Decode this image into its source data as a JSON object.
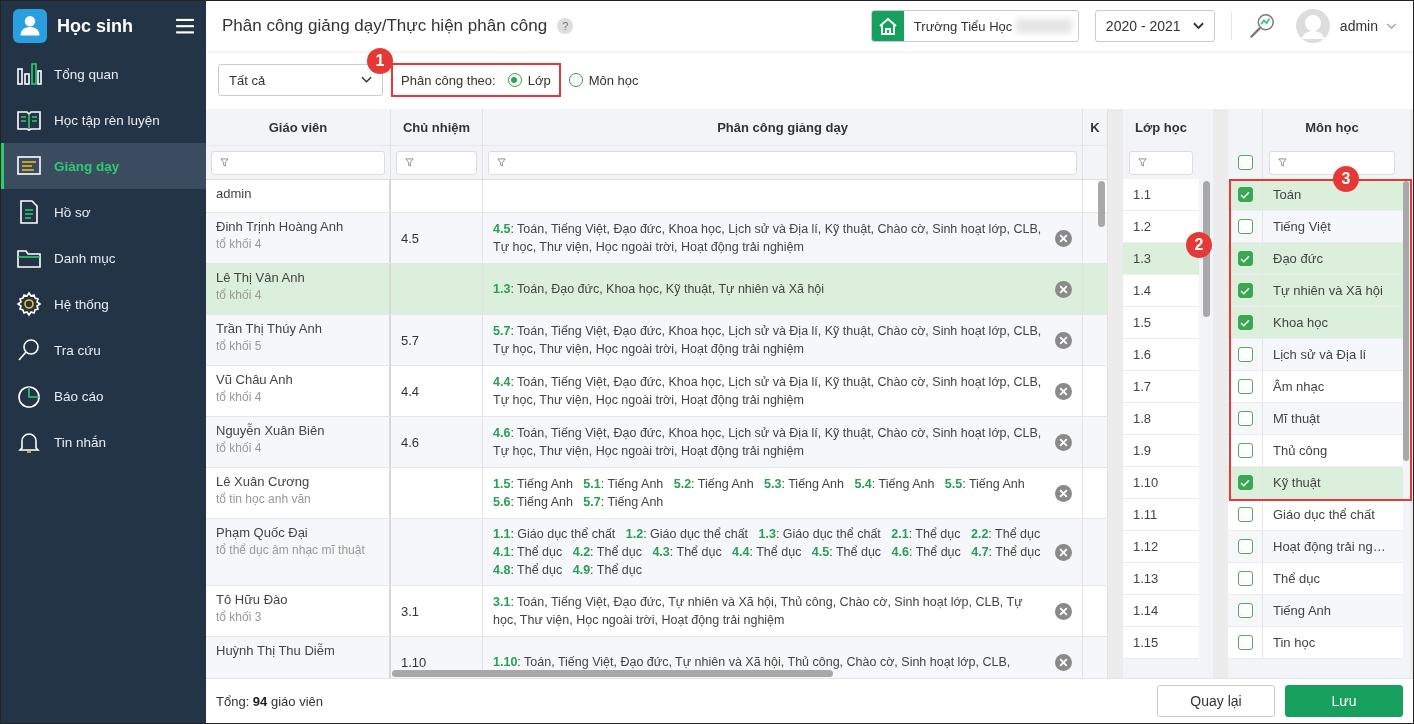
{
  "app": {
    "name": "Học sinh"
  },
  "sidebar": {
    "items": [
      {
        "label": "Tổng quan",
        "selected": false
      },
      {
        "label": "Học tập rèn luyện",
        "selected": false
      },
      {
        "label": "Giảng dạy",
        "selected": true
      },
      {
        "label": "Hồ sơ",
        "selected": false
      },
      {
        "label": "Danh mục",
        "selected": false
      },
      {
        "label": "Hệ thống",
        "selected": false
      },
      {
        "label": "Tra cứu",
        "selected": false
      },
      {
        "label": "Báo cáo",
        "selected": false
      },
      {
        "label": "Tin nhắn",
        "selected": false
      }
    ]
  },
  "header": {
    "title": "Phân công giảng dạy/Thực hiện phân công",
    "help": "?",
    "school": "Trường Tiểu Học",
    "year": "2020 - 2021",
    "user": "admin"
  },
  "toolbar": {
    "filter": "Tất cả",
    "assign_by_label": "Phân công theo:",
    "options": [
      {
        "label": "Lớp",
        "selected": true
      },
      {
        "label": "Môn học",
        "selected": false
      }
    ]
  },
  "teachers": {
    "columns": [
      "Giáo viên",
      "Chủ nhiệm",
      "Phân công giảng dạy",
      "K"
    ],
    "rows": [
      {
        "name": "admin",
        "selected": false
      },
      {
        "name": "Đinh Trịnh Hoàng Anh",
        "group": "tổ khối 4",
        "homeroom": "4.5",
        "assignment": "**4.5**: Toán, Tiếng Việt, Đạo đức, Khoa học, Lịch sử và Địa lí, Kỹ thuật, Chào cờ, Sinh hoạt lớp, CLB, Tự học, Thư viện, Học ngoài trời, Hoạt động trải nghiệm",
        "selected": false
      },
      {
        "name": "Lê Thị Vân Anh",
        "group": "tổ khối 4",
        "assignment": "**1.3**: Toán, Đạo đức, Khoa học, Kỹ thuật, Tự nhiên và Xã hội",
        "selected": true
      },
      {
        "name": "Trần Thị Thúy Anh",
        "group": "tổ khối 5",
        "homeroom": "5.7",
        "assignment": "**5.7**: Toán, Tiếng Việt, Đạo đức, Khoa học, Lịch sử và Địa lí, Kỹ thuật, Chào cờ, Sinh hoạt lớp, CLB, Tự học, Thư viện, Học ngoài trời, Hoạt động trải nghiệm",
        "selected": false
      },
      {
        "name": "Vũ Châu Anh",
        "group": "tổ khối 4",
        "homeroom": "4.4",
        "assignment": "**4.4**: Toán, Tiếng Việt, Đạo đức, Khoa học, Lịch sử và Địa lí, Kỹ thuật, Chào cờ, Sinh hoạt lớp, CLB, Tự học, Thư viện, Học ngoài trời, Hoạt động trải nghiệm",
        "selected": false
      },
      {
        "name": "Nguyễn Xuân Biên",
        "group": "tổ khối 4",
        "homeroom": "4.6",
        "assignment": "**4.6**: Toán, Tiếng Việt, Đạo đức, Khoa học, Lịch sử và Địa lí, Kỹ thuật, Chào cờ, Sinh hoạt lớp, CLB, Tự học, Thư viện, Học ngoài trời, Hoạt động trải nghiệm",
        "selected": false
      },
      {
        "name": "Lê Xuân Cương",
        "group": "tổ tin học anh văn",
        "assignment": "**1.5**: Tiếng Anh   **5.1**: Tiếng Anh   **5.2**: Tiếng Anh   **5.3**: Tiếng Anh   **5.4**: Tiếng Anh   **5.5**: Tiếng Anh   **5.6**: Tiếng Anh   **5.7**: Tiếng Anh",
        "selected": false
      },
      {
        "name": "Phạm Quốc Đại",
        "group": "tổ thể dục âm nhạc mĩ thuật",
        "assignment": "**1.1**: Giáo dục thể chất   **1.2**: Giáo dục thể chất   **1.3**: Giáo dục thể chất   **2.1**: Thể dục   **2.2**: Thể dục   **4.1**: Thể dục   **4.2**: Thể dục   **4.3**: Thể dục   **4.4**: Thể dục   **4.5**: Thể dục   **4.6**: Thể dục   **4.7**: Thể dục   **4.8**: Thể dục   **4.9**: Thể dục",
        "selected": false
      },
      {
        "name": "Tô Hữu Đào",
        "group": "tổ khối 3",
        "homeroom": "3.1",
        "assignment": "**3.1**: Toán, Tiếng Việt, Đạo đức, Tự nhiên và Xã hội, Thủ công, Chào cờ, Sinh hoạt lớp, CLB, Tự học, Thư viện, Học ngoài trời, Hoạt động trải nghiệm",
        "selected": false
      },
      {
        "name": "Huỳnh Thị Thu Diễm",
        "homeroom": "1.10",
        "assignment": "**1.10**: Toán, Tiếng Việt, Đạo đức, Tự nhiên và Xã hội, Thủ công, Chào cờ, Sinh hoạt lớp, CLB,",
        "selected": false
      }
    ]
  },
  "classes": {
    "title": "Lớp học",
    "items": [
      {
        "label": "1.1",
        "selected": false
      },
      {
        "label": "1.2",
        "selected": false
      },
      {
        "label": "1.3",
        "selected": true
      },
      {
        "label": "1.4",
        "selected": false
      },
      {
        "label": "1.5",
        "selected": false
      },
      {
        "label": "1.6",
        "selected": false
      },
      {
        "label": "1.7",
        "selected": false
      },
      {
        "label": "1.8",
        "selected": false
      },
      {
        "label": "1.9",
        "selected": false
      },
      {
        "label": "1.10",
        "selected": false
      },
      {
        "label": "1.11",
        "selected": false
      },
      {
        "label": "1.12",
        "selected": false
      },
      {
        "label": "1.13",
        "selected": false
      },
      {
        "label": "1.14",
        "selected": false
      },
      {
        "label": "1.15",
        "selected": false
      }
    ]
  },
  "subjects": {
    "title": "Môn học",
    "all_checked": false,
    "items": [
      {
        "label": "Toán",
        "checked": true
      },
      {
        "label": "Tiếng Việt",
        "checked": false
      },
      {
        "label": "Đạo đức",
        "checked": true
      },
      {
        "label": "Tự nhiên và Xã hội",
        "checked": true
      },
      {
        "label": "Khoa học",
        "checked": true
      },
      {
        "label": "Lịch sử và Địa lí",
        "checked": false
      },
      {
        "label": "Âm nhạc",
        "checked": false
      },
      {
        "label": "Mĩ thuật",
        "checked": false
      },
      {
        "label": "Thủ công",
        "checked": false
      },
      {
        "label": "Kỹ thuật",
        "checked": true
      },
      {
        "label": "Giáo dục thể chất",
        "checked": false
      },
      {
        "label": "Hoạt động trải ng…",
        "checked": false
      },
      {
        "label": "Thể dục",
        "checked": false
      },
      {
        "label": "Tiếng Anh",
        "checked": false
      },
      {
        "label": "Tin học",
        "checked": false
      }
    ]
  },
  "footer": {
    "total": "Tổng: **94** giáo viên",
    "buttons": [
      {
        "label": "Quay lại",
        "kind": "secondary"
      },
      {
        "label": "Lưu",
        "kind": "primary"
      }
    ]
  },
  "callouts": [
    {
      "label": "1"
    },
    {
      "label": "2"
    },
    {
      "label": "3"
    }
  ]
}
